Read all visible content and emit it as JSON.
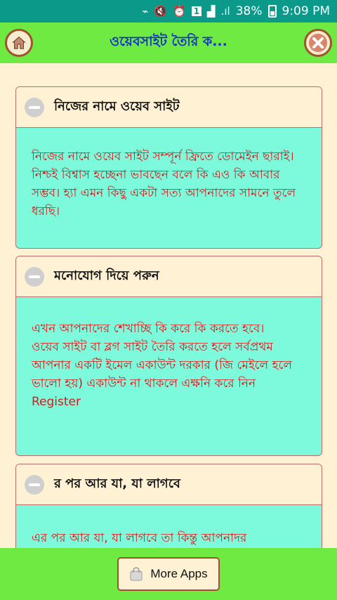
{
  "status_bar": {
    "battery": "38%",
    "time": "9:09 PM",
    "sim": "1"
  },
  "app_bar": {
    "title": "ওয়েবসাইট তৈরি ক..."
  },
  "cards": [
    {
      "title": "নিজের নামে ওয়েব সাইট",
      "body": "নিজের নামে ওয়েব সাইট সম্পূর্ন ফ্রিতে ডোমেইন ছারাই। নিশ্চই বিশ্বাস হচ্ছেনা ভাবছেন বলে কি এও কি আবার সম্ভব। হ্যা এমন কিছু একটা সত্য আপনাদের সামনে তুলে ধরছি।"
    },
    {
      "title": "মনোযোগ দিয়ে পরুন",
      "body_line1": "এখন আপনাদের শেখাচ্ছি কি করে কি করতে হবে।",
      "body_line2": "ওয়েব সাইট বা ব্লগ সাইট তৈরি করতে হলে সর্বপ্রথম আপনার একটি ইমেল একাউন্ট দরকার (জি মেইলে হলে ভালো হয়) একাউন্ট না থাকলে এক্ষনি করে নিন Register"
    },
    {
      "title": "র পর আর যা, যা লাগবে",
      "body": "এর পর আর যা, যা লাগবে তা কিন্তু আপনাদর"
    }
  ],
  "bottom_bar": {
    "more_apps_label": "More Apps"
  }
}
